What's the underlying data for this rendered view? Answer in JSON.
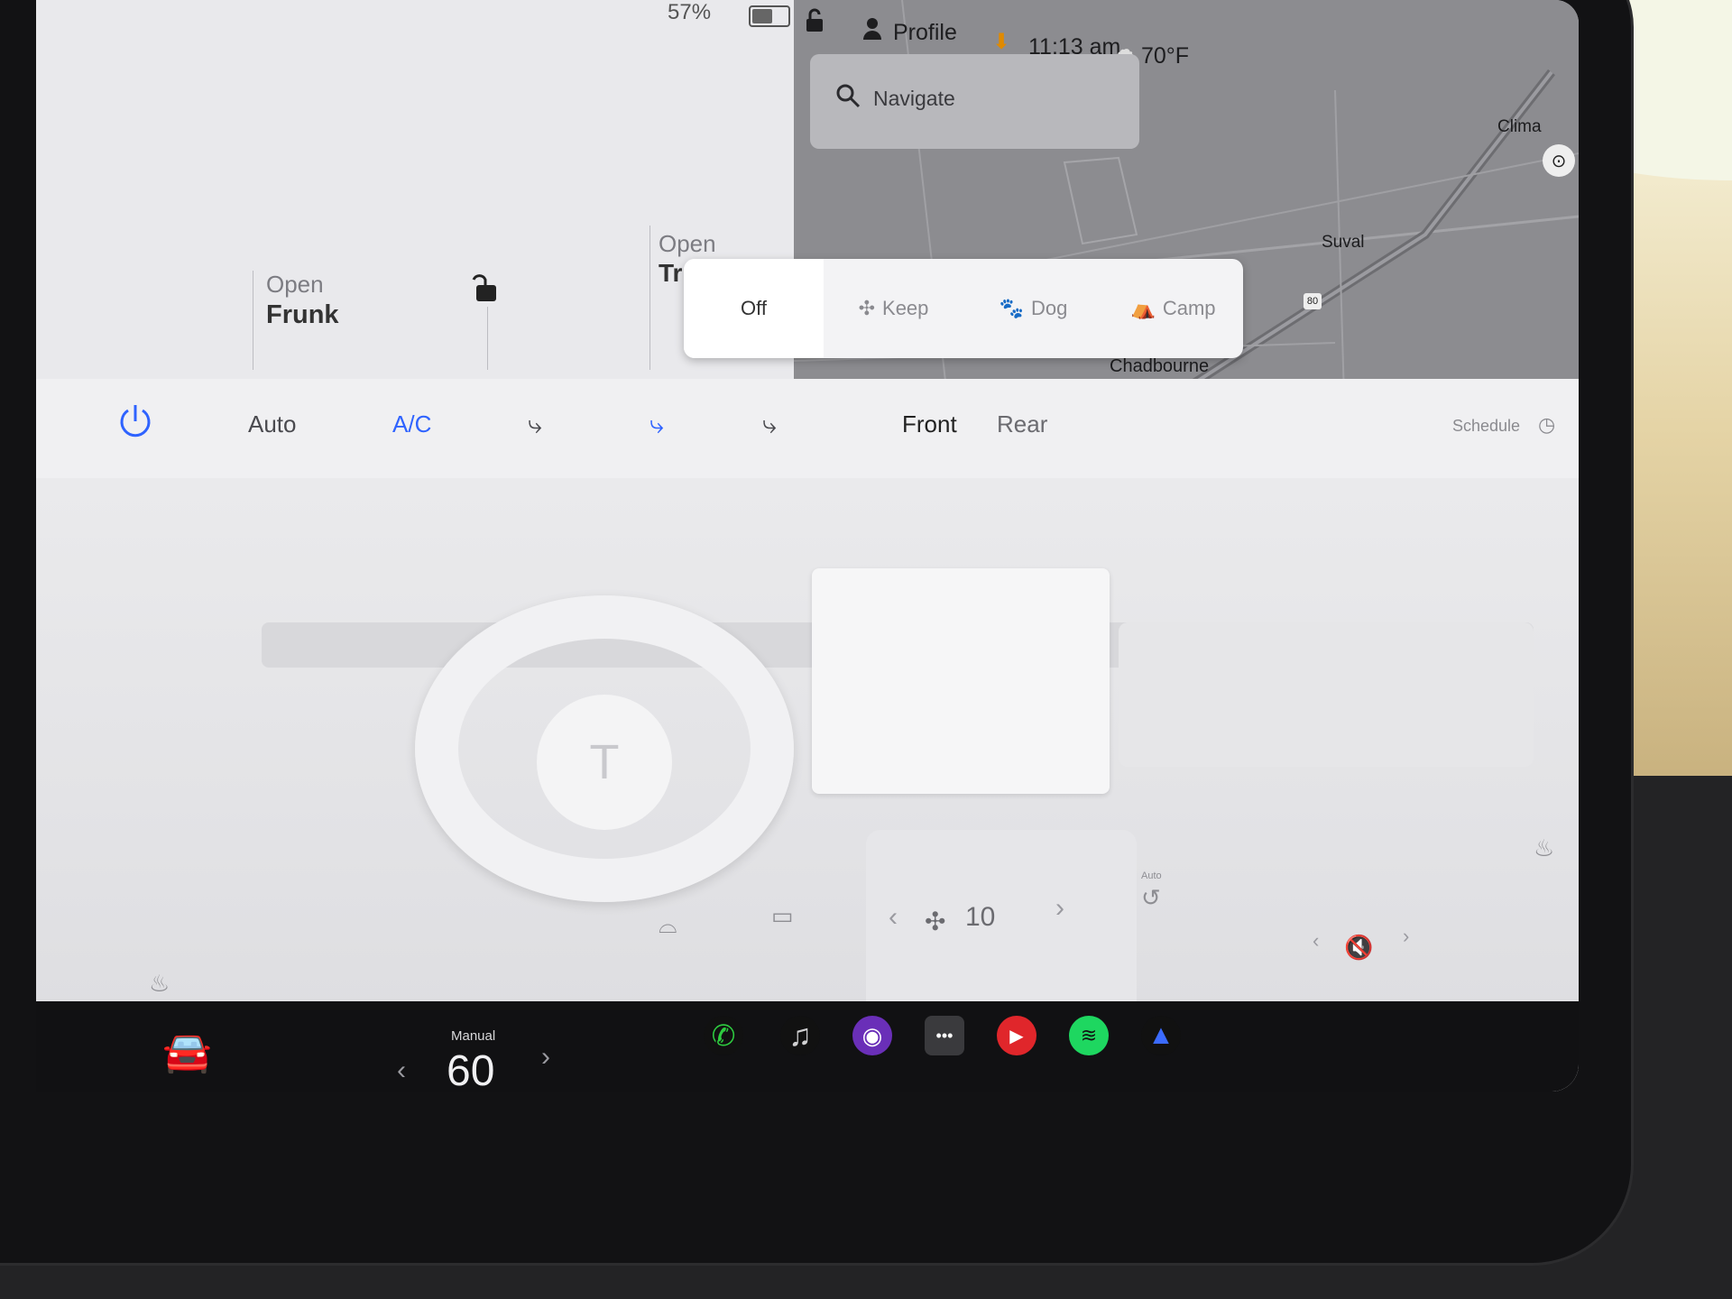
{
  "status_bar": {
    "battery_percent": "57%",
    "profile_label": "Profile",
    "time": "11:13 am",
    "temperature": "70°F"
  },
  "vehicle_panel": {
    "frunk_label": "Open",
    "frunk_value": "Frunk",
    "trunk_label": "Open",
    "trunk_value": "Tr"
  },
  "map": {
    "search_placeholder": "Navigate",
    "labels": [
      "Clima",
      "Suval",
      "Chadbourne"
    ],
    "highway_marker": "80"
  },
  "keep_climate": {
    "options": [
      "Off",
      "Keep",
      "Dog",
      "Camp"
    ],
    "selected": "Off"
  },
  "climate": {
    "auto_label": "Auto",
    "ac_label": "A/C",
    "front_label": "Front",
    "rear_label": "Rear",
    "schedule_label": "Schedule",
    "fan_speed": "10",
    "recirc_label": "Auto",
    "accent_color": "#2f63ff"
  },
  "taskbar": {
    "speed_mode": "Manual",
    "speed_value": "60",
    "apps": [
      "phone-icon",
      "music-icon",
      "camera-icon",
      "more-icon",
      "media-player-icon",
      "spotify-icon",
      "navigation-icon"
    ],
    "volume_state": "muted"
  }
}
